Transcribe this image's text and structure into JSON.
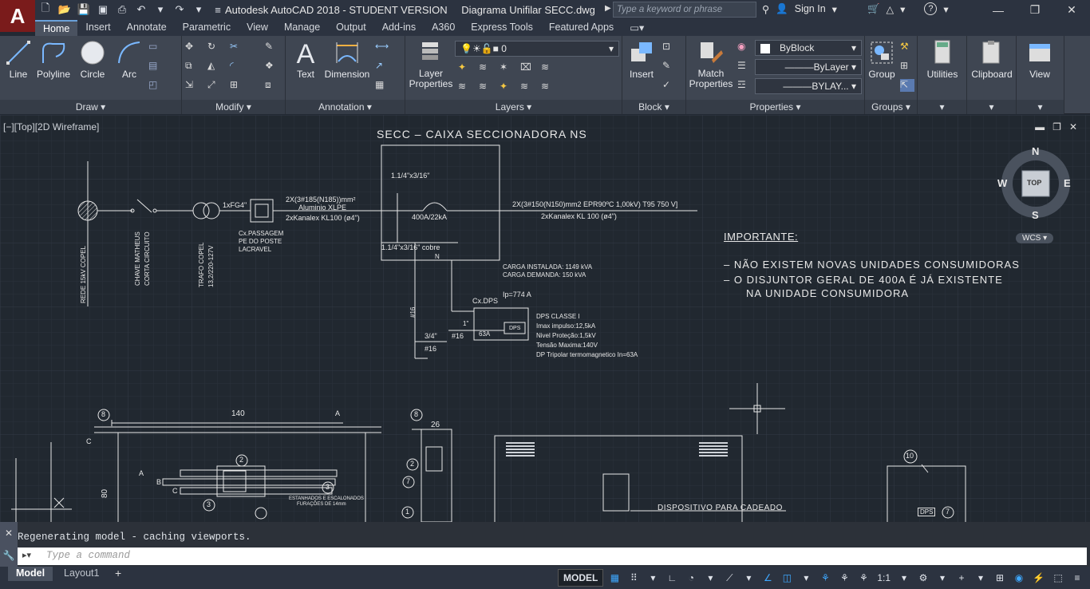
{
  "titlebar": {
    "app_name": "Autodesk AutoCAD 2018 - STUDENT VERSION",
    "file_name": "Diagrama Unifilar SECC.dwg",
    "search_placeholder": "Type a keyword or phrase",
    "sign_in": "Sign In",
    "help": "?"
  },
  "ribbon_tabs": [
    "Home",
    "Insert",
    "Annotate",
    "Parametric",
    "View",
    "Manage",
    "Output",
    "Add-ins",
    "A360",
    "Express Tools",
    "Featured Apps"
  ],
  "ribbon": {
    "draw": {
      "title": "Draw",
      "line": "Line",
      "polyline": "Polyline",
      "circle": "Circle",
      "arc": "Arc"
    },
    "modify": {
      "title": "Modify"
    },
    "annotation": {
      "title": "Annotation",
      "text": "Text",
      "dimension": "Dimension"
    },
    "layers": {
      "title": "Layers",
      "layer_properties": "Layer Properties",
      "current_layer": "0"
    },
    "block": {
      "title": "Block",
      "insert": "Insert"
    },
    "properties": {
      "title": "Properties",
      "match": "Match Properties",
      "color": "ByBlock",
      "linetype": "ByLayer",
      "lineweight": "BYLAY..."
    },
    "groups": {
      "title": "Groups",
      "group": "Group"
    },
    "utilities": "Utilities",
    "clipboard": "Clipboard",
    "view": "View"
  },
  "viewport": {
    "label": "[−][Top][2D Wireframe]",
    "viewcube": {
      "top": "TOP",
      "n": "N",
      "s": "S",
      "e": "E",
      "w": "W",
      "wcs": "WCS"
    }
  },
  "drawing": {
    "title": "SECC – CAIXA SECCIONADORA NS",
    "label_bus1": "1.1/4\"x3/16\"",
    "label_bus2": "1.1/4\"x3/16\" cobre",
    "label_n": "N",
    "label_breaker": "400A/22kA",
    "cable_in_1": "2X(3#185(N185))mm²",
    "cable_in_2": "Aluminio XLPE",
    "cable_in_3": "2xKanalex KL100 (ø4\")",
    "cable_out_1": "2X(3#150(N150)mm2 EPR90ºC 1,00kV) T95 750 V]",
    "cable_out_2": "2xKanalex KL 100 (ø4\")",
    "fg": "1xFG4\"",
    "cx_passagem_1": "Cx.PASSAGEM",
    "cx_passagem_2": "PE DO POSTE",
    "cx_passagem_3": "LACRAVEL",
    "rede": "REDE 15kV COPEL",
    "chave_1": "CHAVE MATHEUS",
    "chave_2": "CORTA CIRCUITO",
    "trafo_1": "TRAFO COPEL",
    "trafo_2": "13,2/220-127V",
    "carga_1": "CARGA INSTALADA: 1149 kVA",
    "carga_2": "CARGA DEMANDA: 150 kVA",
    "ip": "Ip=774 A",
    "cx_dps": "Cx.DPS",
    "dps_box": "DPS",
    "dps_breaker": "63A",
    "dps_1": "DPS CLASSE I",
    "dps_2": "Imax impulso:12,5kA",
    "dps_3": "Nivel Proteção:1,5kV",
    "dps_4": "Tensão Maxima:140V",
    "dps_5": "DP Tripolar termomagnetico In=63A",
    "wire_1": "1\"",
    "wire_2": "#16",
    "wire_3": "3/4\"",
    "wire_4": "#16",
    "wire_5": "#16",
    "importante": "IMPORTANTE:",
    "note_1": "–   NÃO EXISTEM NOVAS UNIDADES CONSUMIDORAS",
    "note_2": "–   O DISJUNTOR GERAL DE 400A É JÁ EXISTENTE",
    "note_3": "NA UNIDADE CONSUMIDORA",
    "dim_140": "140",
    "dim_26": "26",
    "dim_80": "80",
    "cadeado": "DISPOSITIVO PARA CADEADO",
    "furacoes_1": "ESTANHADOS E ESCALONADOS",
    "furacoes_2": "FURAÇÕES DE 14mm",
    "bubble_8a": "8",
    "bubble_8b": "8",
    "bubble_2a": "2",
    "bubble_2b": "2",
    "bubble_3a": "3",
    "bubble_3b": "3",
    "bubble_7": "7",
    "bubble_7b": "7",
    "bubble_1": "1",
    "bubble_10": "10",
    "label_a": "A",
    "label_b": "B",
    "label_c": "C",
    "label_a2": "A",
    "label_c2": "C",
    "label_dps2": "DPS"
  },
  "command": {
    "history": "Regenerating model - caching viewports.",
    "placeholder": "Type a command"
  },
  "status": {
    "tabs": [
      "Model",
      "Layout1"
    ],
    "model": "MODEL",
    "scale": "1:1"
  }
}
